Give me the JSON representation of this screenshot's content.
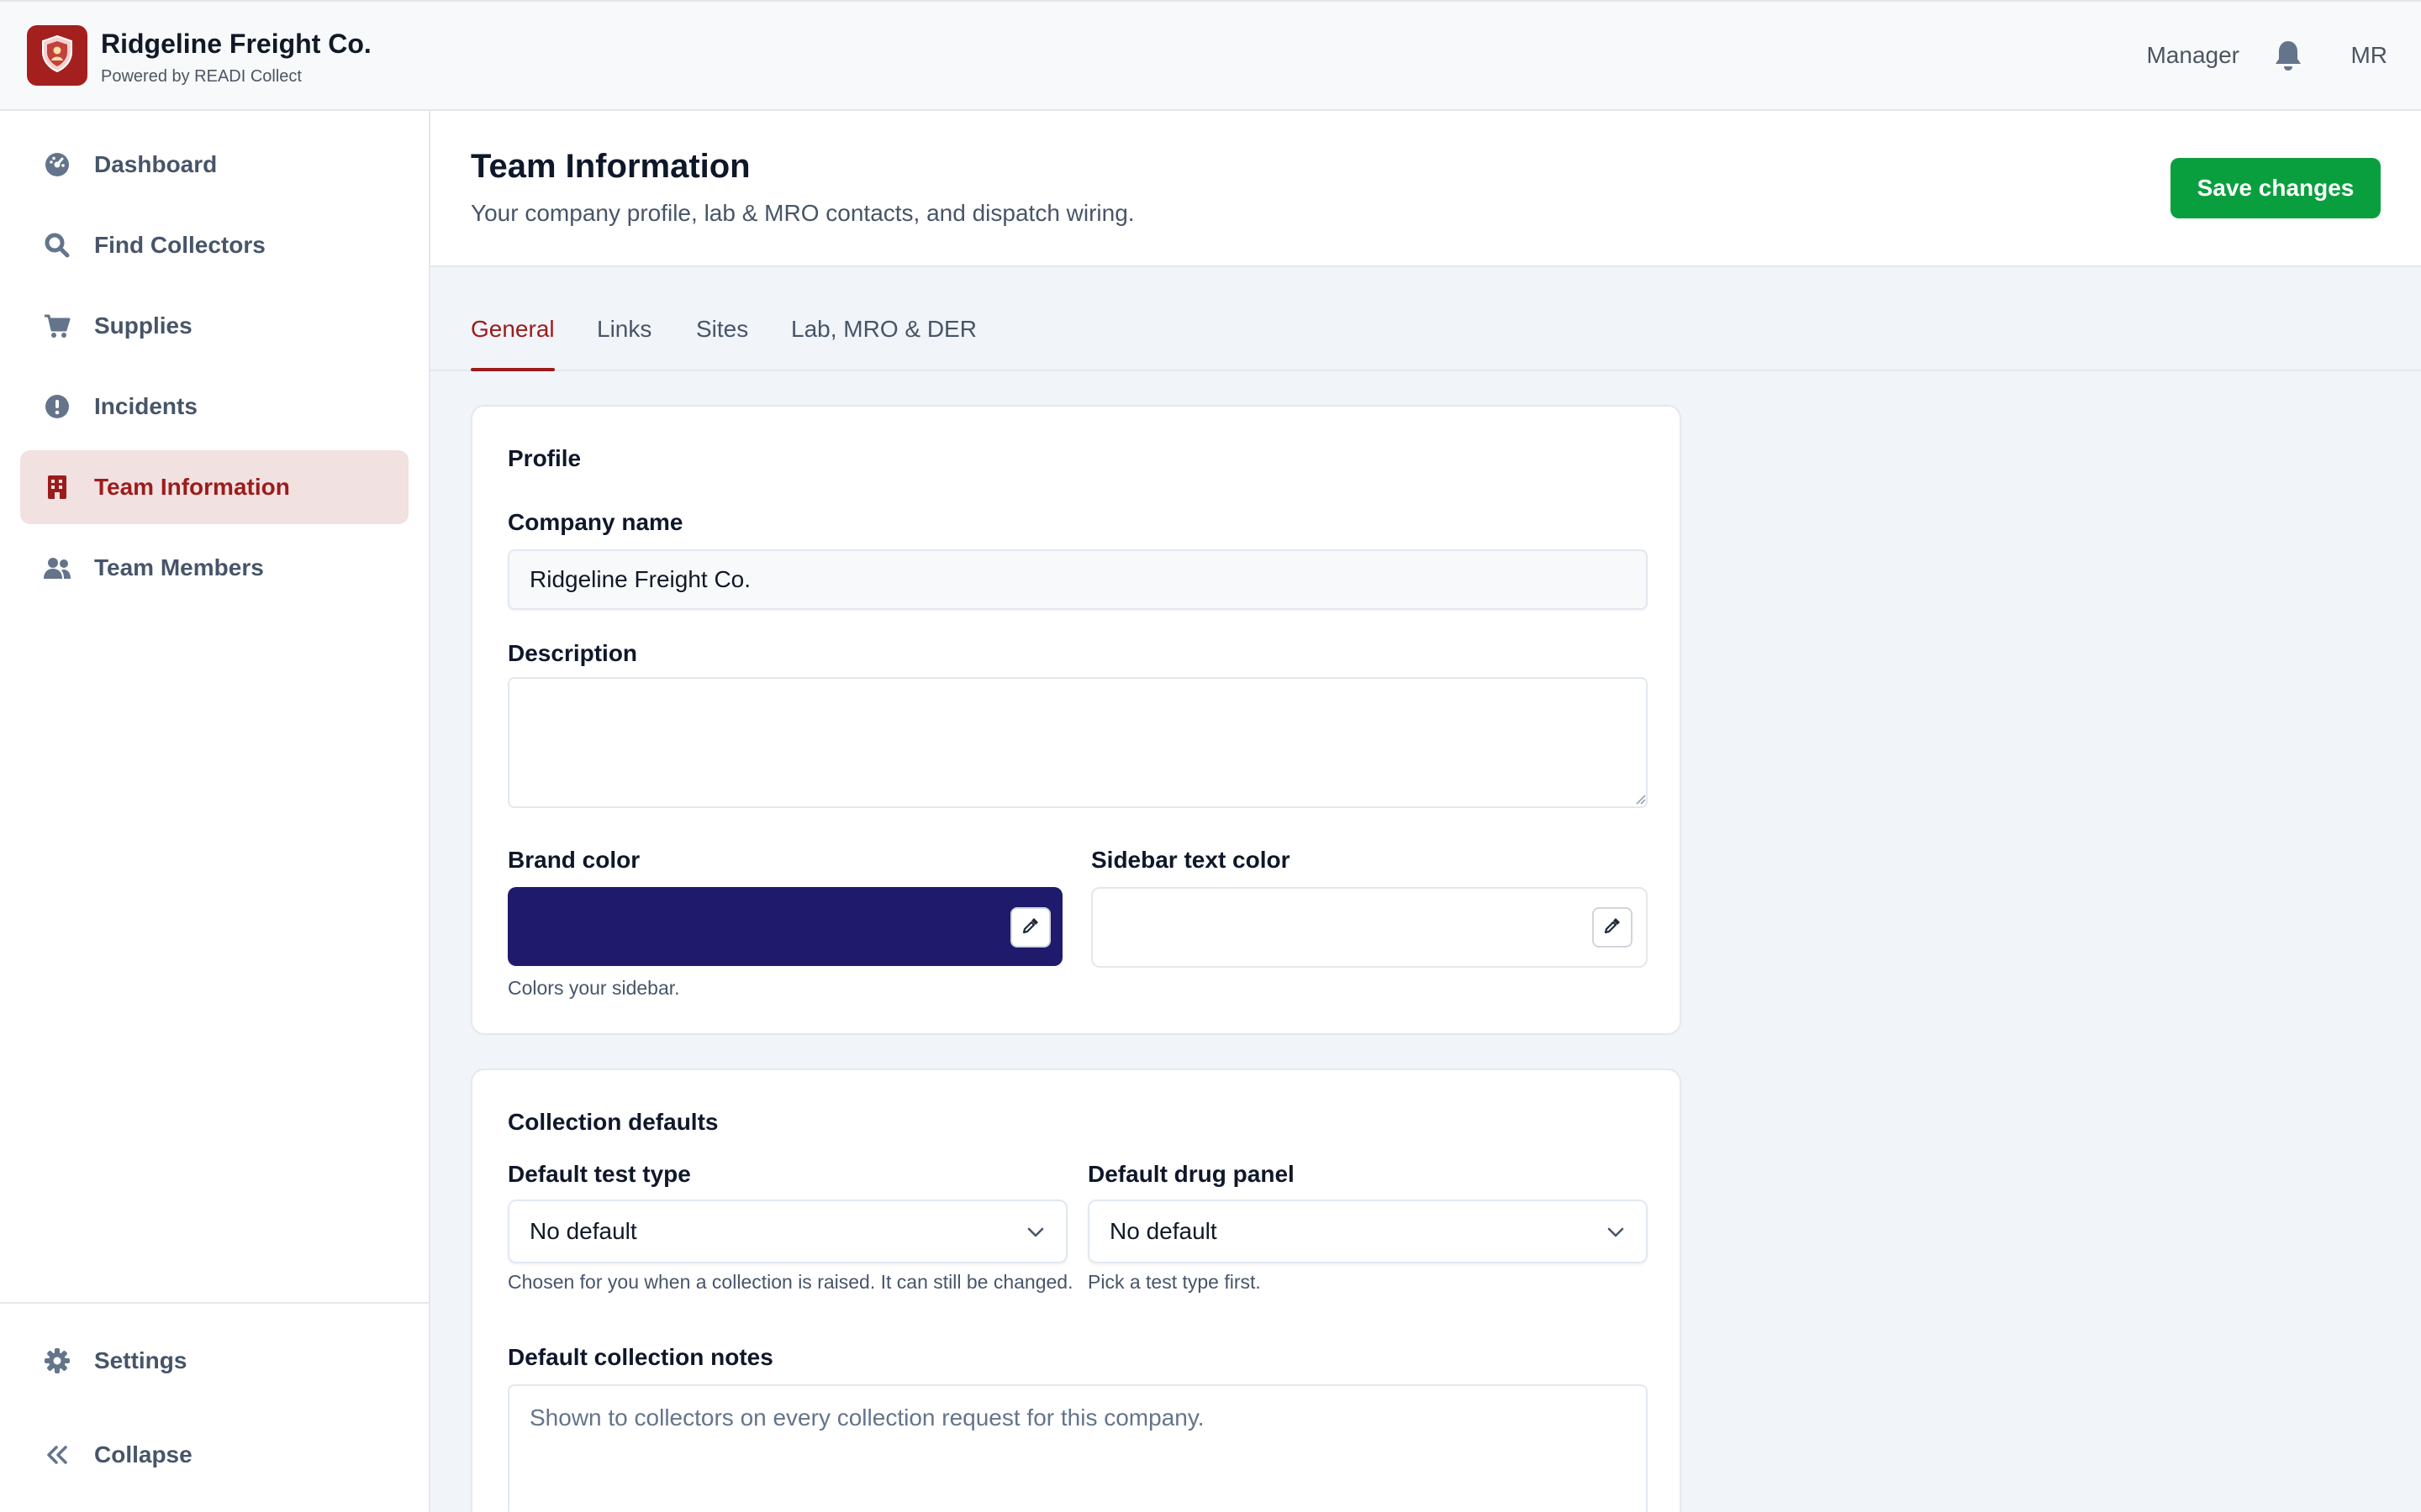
{
  "app": {
    "company_name": "Ridgeline Freight Co.",
    "powered_by": "Powered by READI Collect",
    "logo_icon": "shield-icon",
    "role": "Manager",
    "user_initials": "MR",
    "brand_accent": "#a3201f"
  },
  "sidebar": {
    "items": [
      {
        "label": "Dashboard",
        "icon": "gauge-icon"
      },
      {
        "label": "Find Collectors",
        "icon": "search-icon"
      },
      {
        "label": "Supplies",
        "icon": "cart-icon"
      },
      {
        "label": "Incidents",
        "icon": "alert-icon"
      },
      {
        "label": "Team Information",
        "icon": "building-icon",
        "active": true
      },
      {
        "label": "Team Members",
        "icon": "users-icon"
      }
    ],
    "footer": [
      {
        "label": "Settings",
        "icon": "gear-icon"
      },
      {
        "label": "Collapse",
        "icon": "double-chevron-left-icon"
      }
    ]
  },
  "page": {
    "title": "Team Information",
    "subtitle": "Your company profile, lab & MRO contacts, and dispatch wiring.",
    "save_label": "Save changes"
  },
  "tabs": [
    {
      "label": "General",
      "active": true
    },
    {
      "label": "Links"
    },
    {
      "label": "Sites"
    },
    {
      "label": "Lab, MRO & DER"
    }
  ],
  "profile": {
    "title": "Profile",
    "company_name_label": "Company name",
    "company_name_value": "Ridgeline Freight Co.",
    "description_label": "Description",
    "description_value": "",
    "brand_color_label": "Brand color",
    "brand_color_value": "#1f1a6b",
    "brand_color_help": "Colors your sidebar.",
    "sidebar_text_color_label": "Sidebar text color",
    "sidebar_text_color_value": "#ffffff"
  },
  "collection_defaults": {
    "title": "Collection defaults",
    "test_type_label": "Default test type",
    "test_type_value": "No default",
    "test_type_help": "Chosen for you when a collection is raised. It can still be changed.",
    "drug_panel_label": "Default drug panel",
    "drug_panel_value": "No default",
    "drug_panel_help": "Pick a test type first.",
    "notes_label": "Default collection notes",
    "notes_placeholder": "Shown to collectors on every collection request for this company."
  }
}
